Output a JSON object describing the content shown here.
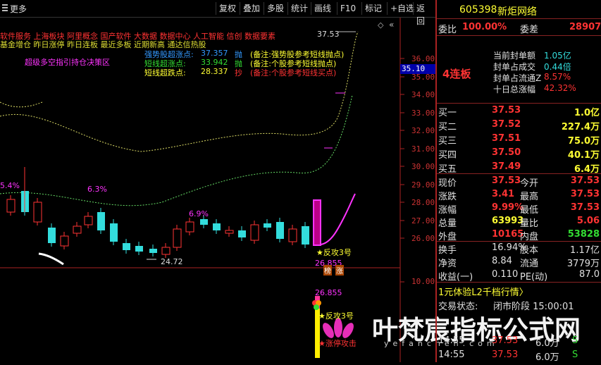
{
  "toolbar": {
    "more": "更多",
    "buttons": [
      "复权",
      "叠加",
      "多股",
      "统计",
      "画线",
      "F10",
      "标记",
      "+自选",
      "返回"
    ]
  },
  "chart": {
    "overlay_lines": [
      "软件服务 上海板块 阿里概念 国产软件 大数据 数据中心 人工智能 信创 数据要素",
      "基金增仓 昨日涨停 昨日连板 最近多板 近期新高 通达信热股"
    ],
    "strategy": "超级多空指引持仓决策区",
    "ind1_label": "强势股超涨点:",
    "ind1_value": "37.357",
    "ind1_sig": "抛",
    "ind1_note": "(备注:强势股参考短线抛点)",
    "ind2_label": "短线超涨点:",
    "ind2_value": "33.942",
    "ind2_sig": "抛",
    "ind2_note": "(备注:个股参考短线抛点)",
    "ind3_label": "短线超跌点:",
    "ind3_value": "28.337",
    "ind3_sig": "抄",
    "ind3_note": "(备注:个股参考短线买点)",
    "top_price": "37.53",
    "pct1": "5.4%",
    "pct2": "6.3%",
    "pct3": "6.9%",
    "low_price": "24.72",
    "fangong1": "★反攻3号",
    "sub_price": "26.855",
    "badge1": "榜",
    "badge2": "涨",
    "sub_price2": "26.855",
    "fangong2": "★反攻3号",
    "zhangting": "★涨停攻击",
    "axis": [
      "36.00",
      "35.00",
      "34.00",
      "33.00",
      "32.00",
      "31.00",
      "30.00",
      "29.00",
      "28.00",
      "27.00",
      "26.00"
    ],
    "axis_highlight": "35.10",
    "axis_sub": "10.00",
    "watermark": "叶梵宸指标公式网",
    "watermark_url": "yefanchen.com"
  },
  "quote": {
    "code": "605398",
    "name": "新炬网络",
    "weibi_label": "委比",
    "weibi_value": "100.00%",
    "weicha_label": "委差",
    "weicha_value": "28907",
    "lianban": "4连板",
    "seal_items": [
      {
        "label": "当前封单额",
        "value": "1.05亿"
      },
      {
        "label": "封单占成交",
        "value": "0.44倍"
      },
      {
        "label": "封单占流通Z",
        "value": "8.57%"
      },
      {
        "label": "十日总涨幅",
        "value": "42.32%"
      }
    ],
    "bids": [
      {
        "label": "买一",
        "price": "37.53",
        "vol": "1.0亿"
      },
      {
        "label": "买二",
        "price": "37.52",
        "vol": "227.4万"
      },
      {
        "label": "买三",
        "price": "37.51",
        "vol": "75.0万"
      },
      {
        "label": "买四",
        "price": "37.50",
        "vol": "40.1万"
      },
      {
        "label": "买五",
        "price": "37.49",
        "vol": "6.4万"
      }
    ],
    "stats": [
      {
        "l1": "现价",
        "v1": "37.53",
        "l2": "今开",
        "v2": "37.53"
      },
      {
        "l1": "涨跌",
        "v1": "3.41",
        "l2": "最高",
        "v2": "37.53"
      },
      {
        "l1": "涨幅",
        "v1": "9.99%",
        "l2": "最低",
        "v2": "37.53"
      },
      {
        "l1": "总量",
        "v1": "63993",
        "l2": "量比",
        "v2": "5.06"
      },
      {
        "l1": "外盘",
        "v1": "10165",
        "l2": "内盘",
        "v2": "53828"
      }
    ],
    "stats2": [
      {
        "l1": "换手",
        "v1": "16.94%",
        "l2": "股本",
        "v2": "1.17亿"
      },
      {
        "l1": "净资",
        "v1": "8.84",
        "l2": "流通",
        "v2": "3779万"
      },
      {
        "l1": "收益(一)",
        "v1": "0.110",
        "l2": "PE(动)",
        "v2": "87.0"
      }
    ],
    "l2_promo": "1元体验L2千档行情〉",
    "trade_status_label": "交易状态:",
    "trade_status_value": "闭市阶段 15:00:01",
    "ticks": [
      {
        "time": "14:55",
        "price": "37.53",
        "vol": "6.0万",
        "side": "S"
      },
      {
        "time": "14:55",
        "price": "37.53",
        "vol": "6.0万",
        "side": "S"
      }
    ]
  }
}
